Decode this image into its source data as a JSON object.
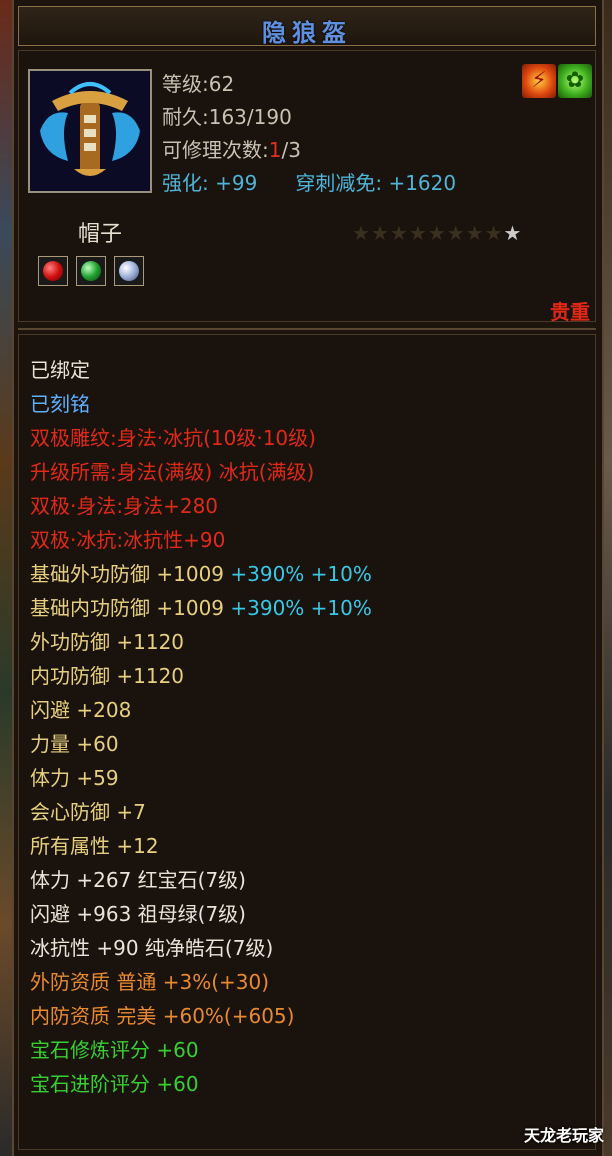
{
  "item": {
    "name": "隐狼盔",
    "level": "等级:62",
    "durability": "耐久:163/190",
    "repair_label": "可修理次数:",
    "repair_used": "1",
    "repair_total": "/3",
    "enhance_label": "强化:",
    "enhance_value": "+99",
    "pierce_label": "穿刺减免:",
    "pierce_value": "+1620",
    "type": "帽子",
    "stars_total": 9,
    "rarity": "贵重",
    "badges": [
      "fire-emblem",
      "leaf-emblem"
    ],
    "gems": [
      "ruby",
      "emerald",
      "diamond"
    ]
  },
  "attributes": {
    "bound": "已绑定",
    "engraved": "已刻铭",
    "dual_carving": "双极雕纹:身法·冰抗(10级·10级)",
    "upgrade_req": "升级所需:身法(满级) 冰抗(满级)",
    "dual_agility": "双极·身法:身法+280",
    "dual_ice": "双极·冰抗:冰抗性+90",
    "base_outer_def": "基础外功防御 +1009",
    "base_outer_def_bonus": "+390% +10%",
    "base_inner_def": "基础内功防御 +1009",
    "base_inner_def_bonus": "+390% +10%",
    "outer_def": "外功防御 +1120",
    "inner_def": "内功防御 +1120",
    "dodge": "闪避 +208",
    "strength": "力量 +60",
    "stamina": "体力 +59",
    "crit_def": "会心防御 +7",
    "all_attr": "所有属性 +12",
    "gem_stamina": "体力 +267 红宝石(7级)",
    "gem_dodge": "闪避 +963 祖母绿(7级)",
    "gem_ice": "冰抗性 +90 纯净皓石(7级)",
    "outer_quality": "外防资质  普通 +3%(+30)",
    "inner_quality": "内防资质  完美 +60%(+605)",
    "gem_refine_score": "宝石修炼评分 +60",
    "gem_advance_score": "宝石进阶评分 +60"
  },
  "watermark": "天龙老玩家",
  "colors": {
    "title": "#5f8fe0",
    "red": "#e02a18",
    "gold": "#e6d080",
    "cyan": "#37c8e8",
    "orange": "#e88a30",
    "green": "#38d030"
  }
}
